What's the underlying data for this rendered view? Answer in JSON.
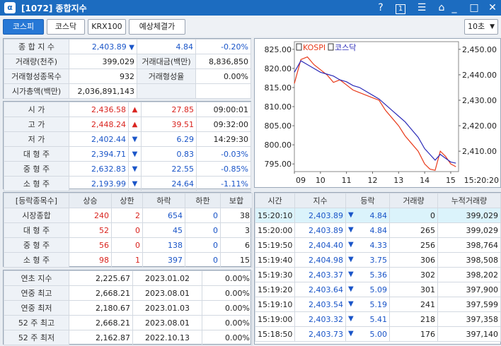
{
  "window": {
    "title": "[1072] 종합지수",
    "help": "?",
    "num_badge": "1"
  },
  "tabs": [
    {
      "label": "코스피",
      "active": true
    },
    {
      "label": "코스닥"
    },
    {
      "label": "KRX100"
    },
    {
      "label": "예상체결가"
    }
  ],
  "interval": "10초",
  "summary": [
    {
      "l1": "종 합 지 수",
      "v1": "2,403.89",
      "arrow": "▼",
      "chg": "4.84",
      "pct": "-0.20%"
    },
    {
      "l1": "거래량(천주)",
      "v1": "399,029",
      "l2": "거래대금(백만)",
      "v2": "8,836,850"
    },
    {
      "l1": "거래형성종목수",
      "v1": "932",
      "l2": "거래형성율",
      "v2": "0.00%"
    },
    {
      "l1": "시가총액(백만)",
      "v1": "2,036,891,143"
    }
  ],
  "prices": [
    {
      "label": "시 가",
      "value": "2,436.58",
      "arrow": "▲",
      "chg": "27.85",
      "extra": "09:00:01",
      "dir": "up"
    },
    {
      "label": "고 가",
      "value": "2,448.24",
      "arrow": "▲",
      "chg": "39.51",
      "extra": "09:32:00",
      "dir": "up"
    },
    {
      "label": "저 가",
      "value": "2,402.44",
      "arrow": "▼",
      "chg": "6.29",
      "extra": "14:29:30",
      "dir": "down"
    },
    {
      "label": "대 형 주",
      "value": "2,394.71",
      "arrow": "▼",
      "chg": "0.83",
      "extra": "-0.03%",
      "dir": "down"
    },
    {
      "label": "중 형 주",
      "value": "2,632.83",
      "arrow": "▼",
      "chg": "22.55",
      "extra": "-0.85%",
      "dir": "down"
    },
    {
      "label": "소 형 주",
      "value": "2,193.99",
      "arrow": "▼",
      "chg": "24.64",
      "extra": "-1.11%",
      "dir": "down"
    }
  ],
  "breadth": {
    "headers": [
      "[등락종목수]",
      "상승",
      "상한",
      "하락",
      "하한",
      "보합"
    ],
    "rows": [
      [
        "시장종합",
        "240",
        "2",
        "654",
        "0",
        "38"
      ],
      [
        "대 형 주",
        "52",
        "0",
        "45",
        "0",
        "3"
      ],
      [
        "중 형 주",
        "56",
        "0",
        "138",
        "0",
        "6"
      ],
      [
        "소 형 주",
        "98",
        "1",
        "397",
        "0",
        "15"
      ]
    ]
  },
  "records": [
    [
      "연초  지수",
      "2,225.67",
      "2023.01.02",
      "0.00%"
    ],
    [
      "연중  최고",
      "2,668.21",
      "2023.08.01",
      "0.00%"
    ],
    [
      "연중  최저",
      "2,180.67",
      "2023.01.03",
      "0.00%"
    ],
    [
      "52 주 최고",
      "2,668.21",
      "2023.08.01",
      "0.00%"
    ],
    [
      "52 주 최저",
      "2,162.87",
      "2022.10.13",
      "0.00%"
    ]
  ],
  "ticks": {
    "headers": [
      "시간",
      "지수",
      "등락",
      "거래량",
      "누적거래량"
    ],
    "rows": [
      [
        "15:20:10",
        "2,403.89",
        "▼",
        "4.84",
        "0",
        "399,029"
      ],
      [
        "15:20:00",
        "2,403.89",
        "▼",
        "4.84",
        "265",
        "399,029"
      ],
      [
        "15:19:50",
        "2,404.40",
        "▼",
        "4.33",
        "256",
        "398,764"
      ],
      [
        "15:19:40",
        "2,404.98",
        "▼",
        "3.75",
        "306",
        "398,508"
      ],
      [
        "15:19:30",
        "2,403.37",
        "▼",
        "5.36",
        "302",
        "398,202"
      ],
      [
        "15:19:20",
        "2,403.64",
        "▼",
        "5.09",
        "301",
        "397,900"
      ],
      [
        "15:19:10",
        "2,403.54",
        "▼",
        "5.19",
        "241",
        "397,599"
      ],
      [
        "15:19:00",
        "2,403.32",
        "▼",
        "5.41",
        "218",
        "397,358"
      ],
      [
        "15:18:50",
        "2,403.73",
        "▼",
        "5.00",
        "176",
        "397,140"
      ]
    ]
  },
  "chart_data": {
    "type": "line",
    "legend": [
      "KOSPI",
      "코스닥"
    ],
    "left_axis_ticks": [
      "825.00",
      "820.00",
      "815.00",
      "810.00",
      "805.00",
      "800.00",
      "795.00"
    ],
    "left_ylim": [
      793,
      827
    ],
    "right_axis_ticks": [
      "2,450.00",
      "2,440.00",
      "2,430.00",
      "2,420.00",
      "2,410.00"
    ],
    "right_ylim": [
      2402,
      2453
    ],
    "x_ticks": [
      "09",
      "10",
      "11",
      "12",
      "13",
      "14",
      "15"
    ],
    "time_label": "15:20:20",
    "series": [
      {
        "name": "KOSPI",
        "axis": "right",
        "color": "#e83a1a",
        "x": [
          9.0,
          9.25,
          9.5,
          9.75,
          10.0,
          10.25,
          10.5,
          10.75,
          11.0,
          11.25,
          11.5,
          11.75,
          12.0,
          12.25,
          12.5,
          12.75,
          13.0,
          13.25,
          13.5,
          13.75,
          14.0,
          14.2,
          14.4,
          14.6,
          14.8,
          15.0,
          15.2
        ],
        "values": [
          2436.6,
          2446,
          2447,
          2444,
          2442,
          2440,
          2437,
          2438,
          2436,
          2434,
          2433,
          2432,
          2431,
          2430,
          2426,
          2423,
          2420,
          2416,
          2413,
          2410,
          2405,
          2403,
          2402.5,
          2410,
          2408,
          2405,
          2403.9
        ]
      },
      {
        "name": "코스닥",
        "axis": "left",
        "color": "#2b2bb8",
        "x": [
          9.0,
          9.25,
          9.5,
          9.75,
          10.0,
          10.25,
          10.5,
          10.75,
          11.0,
          11.25,
          11.5,
          11.75,
          12.0,
          12.25,
          12.5,
          12.75,
          13.0,
          13.25,
          13.5,
          13.75,
          14.0,
          14.2,
          14.4,
          14.6,
          14.8,
          15.0,
          15.2
        ],
        "values": [
          819,
          822,
          821,
          820,
          819,
          818.5,
          818,
          817,
          816.5,
          815.5,
          815,
          814,
          813,
          812,
          810.5,
          809,
          807.5,
          806,
          804,
          802,
          799,
          797.5,
          796,
          797.5,
          796.5,
          795.5,
          795.2
        ]
      }
    ]
  }
}
